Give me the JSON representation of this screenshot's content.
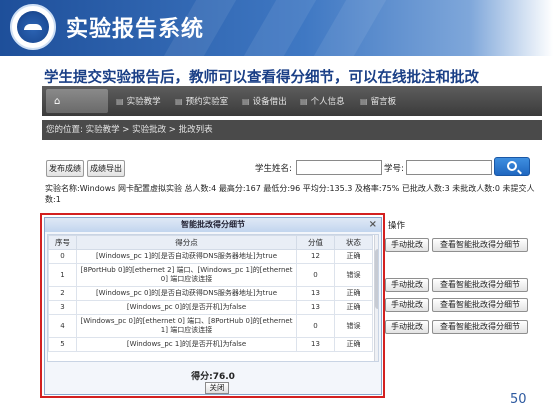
{
  "slide": {
    "title": "实验报告系统",
    "subtitle": "学生提交实验报告后，教师可以查看得分细节，可以在线批注和批改",
    "page_number": "50"
  },
  "app": {
    "nav": {
      "home_icon": "home-icon",
      "items": [
        {
          "label": "实验教学",
          "icon": "book-icon"
        },
        {
          "label": "预约实验室",
          "icon": "calendar-icon"
        },
        {
          "label": "设备借出",
          "icon": "device-icon"
        },
        {
          "label": "个人信息",
          "icon": "user-icon"
        },
        {
          "label": "留言板",
          "icon": "message-icon"
        }
      ]
    },
    "breadcrumb": "您的位置: 实验教学 > 实验批改 > 批改列表",
    "toolbar": {
      "publish_label": "发布成绩",
      "export_label": "成绩导出",
      "student_name_label": "学生姓名:",
      "student_name_value": "",
      "student_id_label": "学号:",
      "student_id_value": "",
      "search_icon": "search-icon"
    },
    "stats": "实验名称:Windows 网卡配置虚拟实验 总人数:4 最高分:167 最低分:96 平均分:135.3 及格率:75% 已批改人数:3 未批改人数:0 未提交人数:1",
    "actions_header": "操作",
    "row_actions": [
      {
        "manual": "手动批改",
        "detail": "查看智能批改得分细节"
      },
      {
        "manual": "手动批改",
        "detail": "查看智能批改得分细节"
      },
      {
        "manual": "手动批改",
        "detail": "查看智能批改得分细节"
      },
      {
        "manual": "手动批改",
        "detail": "查看智能批改得分细节"
      }
    ]
  },
  "modal": {
    "title": "智能批改得分细节",
    "close_glyph": "×",
    "columns": [
      "序号",
      "得分点",
      "分值",
      "状态"
    ],
    "rows": [
      {
        "index": "0",
        "point": "[Windows_pc 1]的[是否自动获得DNS服务器地址]为true",
        "score": "12",
        "status": "正确"
      },
      {
        "index": "1",
        "point": "[8PortHub 0]的[ethernet 2] 端口、[Windows_pc 1]的[ethernet 0] 端口应该连接",
        "score": "0",
        "status": "错误"
      },
      {
        "index": "2",
        "point": "[Windows_pc 0]的[是否自动获得DNS服务器地址]为true",
        "score": "13",
        "status": "正确"
      },
      {
        "index": "3",
        "point": "[Windows_pc 0]的[是否开机]为false",
        "score": "13",
        "status": "正确"
      },
      {
        "index": "4",
        "point": "[Windows_pc 0]的[ethernet 0] 端口、[8PortHub 0]的[ethernet 1] 端口应该连接",
        "score": "0",
        "status": "错误"
      },
      {
        "index": "5",
        "point": "[Windows_pc 1]的[是否开机]为false",
        "score": "13",
        "status": "正确"
      }
    ],
    "score_text": "得分:76.0",
    "close_label": "关闭"
  },
  "colors": {
    "header_blue": "#1e4f9a",
    "highlight_red": "#d32020",
    "nav_dark": "#3b3b3b"
  }
}
